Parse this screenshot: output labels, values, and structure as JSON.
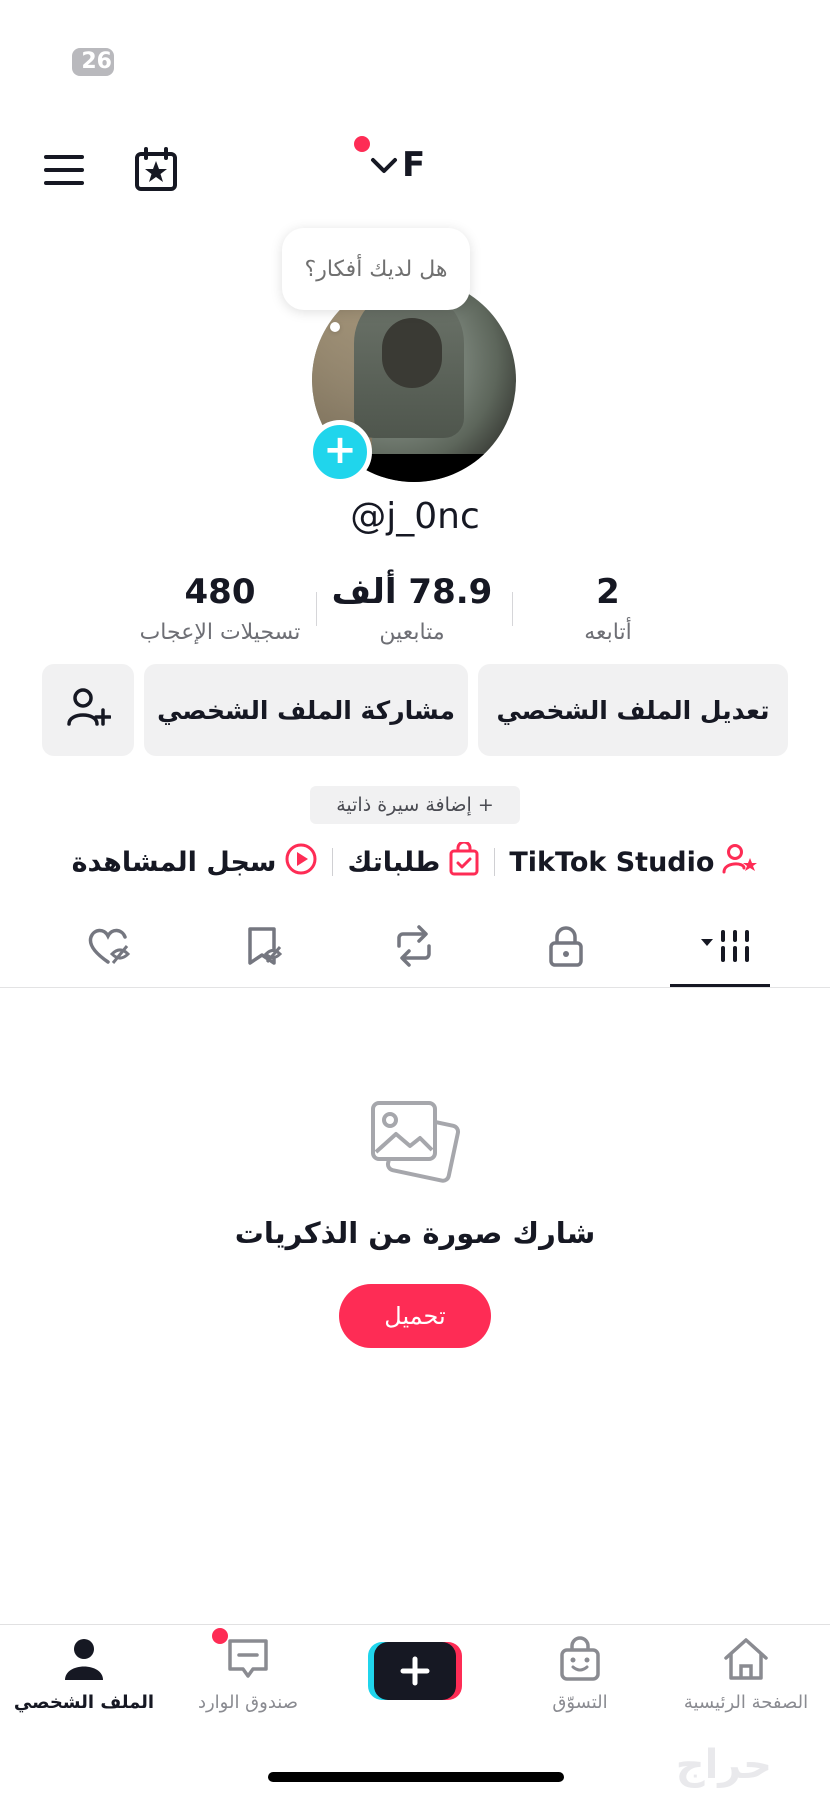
{
  "status": {
    "indicator": "26"
  },
  "header": {
    "account_initial": "F",
    "menu_icon": "hamburger-menu-icon",
    "calendar_icon": "calendar-star-icon"
  },
  "tooltip": {
    "text": "هل لديك أفكار؟"
  },
  "profile": {
    "username": "@j_0nc",
    "stats": [
      {
        "value": "2",
        "label": "أتابعه"
      },
      {
        "value": "78.9 ألف",
        "label": "متابعين"
      },
      {
        "value": "480",
        "label": "تسجيلات الإعجاب"
      }
    ],
    "edit_profile": "تعديل الملف الشخصي",
    "share_profile": "مشاركة الملف الشخصي",
    "add_bio": "+ إضافة سيرة ذاتية"
  },
  "quick_links": [
    {
      "label": "TikTok Studio",
      "icon": "user-star-icon"
    },
    {
      "label": "طلباتك",
      "icon": "shopping-bag-check-icon"
    },
    {
      "label": "سجل المشاهدة",
      "icon": "play-circle-icon"
    }
  ],
  "tabs": [
    "videos-grid",
    "private-lock",
    "reposts",
    "favorites",
    "liked"
  ],
  "empty_state": {
    "title": "شارك صورة من الذكريات",
    "upload": "تحميل"
  },
  "bottom_nav": {
    "home": "الصفحة الرئيسية",
    "shop": "التسوّق",
    "inbox": "صندوق الوارد",
    "profile": "الملف الشخصي"
  },
  "watermark": "حراج",
  "colors": {
    "accent": "#fe2c55",
    "cyan": "#20d5ec",
    "text": "#161823",
    "muted": "#6e6f75"
  }
}
